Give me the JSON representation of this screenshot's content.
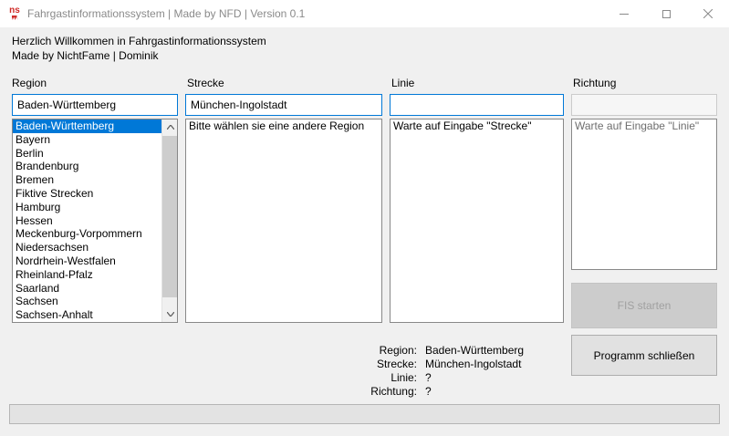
{
  "window": {
    "title": "Fahrgastinformationssystem | Made by NFD | Version 0.1",
    "icon_text": "ns",
    "icons": {
      "minimize": "minimize-icon",
      "maximize": "maximize-icon",
      "close": "close-icon"
    }
  },
  "welcome": {
    "line1": "Herzlich Willkommen in Fahrgastinformationssystem",
    "line2": "Made by NichtFame | Dominik"
  },
  "columns": {
    "region": {
      "label": "Region",
      "input_value": "Baden-Württemberg",
      "selected_index": 0,
      "items": [
        "Baden-Württemberg",
        "Bayern",
        "Berlin",
        "Brandenburg",
        "Bremen",
        "Fiktive Strecken",
        "Hamburg",
        "Hessen",
        "Meckenburg-Vorpommern",
        "Niedersachsen",
        "Nordrhein-Westfalen",
        "Rheinland-Pfalz",
        "Saarland",
        "Sachsen",
        "Sachsen-Anhalt"
      ]
    },
    "strecke": {
      "label": "Strecke",
      "input_value": "München-Ingolstadt",
      "items": [
        "Bitte wählen sie eine andere Region"
      ]
    },
    "linie": {
      "label": "Linie",
      "input_value": "",
      "items": [
        "Warte auf Eingabe \"Strecke\""
      ]
    },
    "richtung": {
      "label": "Richtung",
      "input_value": "",
      "items": [
        "Warte auf Eingabe \"Linie\""
      ]
    }
  },
  "buttons": {
    "fis_start": {
      "label": "FIS starten",
      "enabled": false
    },
    "close_program": {
      "label": "Programm schließen",
      "enabled": true
    }
  },
  "status": {
    "rows": [
      {
        "label": "Region:",
        "value": "Baden-Württemberg"
      },
      {
        "label": "Strecke:",
        "value": "München-Ingolstadt"
      },
      {
        "label": "Linie:",
        "value": "?"
      },
      {
        "label": "Richtung:",
        "value": "?"
      }
    ]
  },
  "progress": {
    "value_percent": 0
  },
  "colors": {
    "accent": "#0078d7",
    "selection_bg": "#0078d7",
    "app_icon_red": "#cf2a27",
    "disabled_text": "#a0a0a0",
    "titlebar_text": "#8a8a8a"
  }
}
